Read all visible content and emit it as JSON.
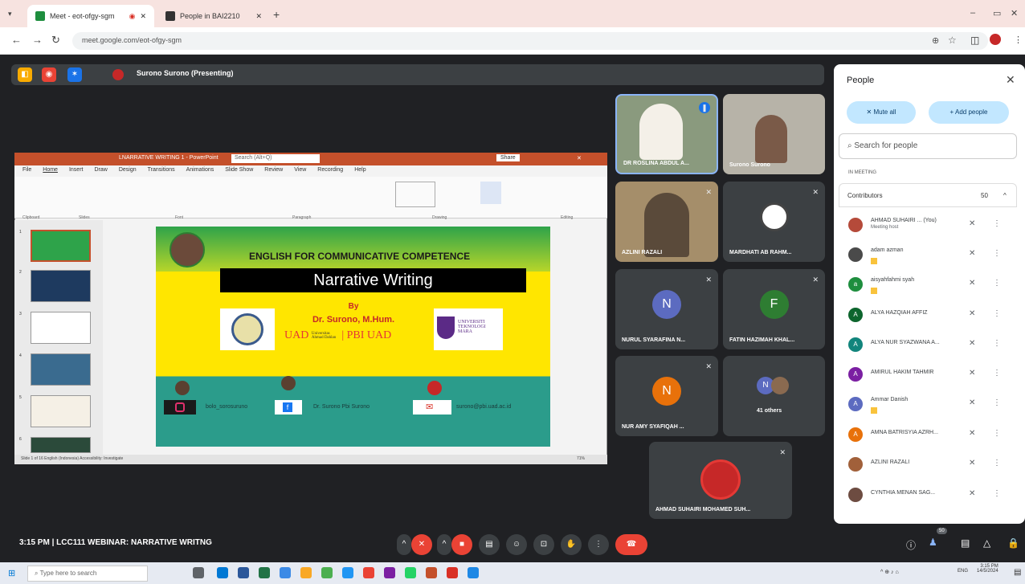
{
  "browser": {
    "tabs": [
      {
        "label": "Meet - eot-ofgy-sgm"
      },
      {
        "label": "People in BAI2210"
      }
    ],
    "url": "meet.google.com/eot-ofgy-sgm",
    "new_tab": "+"
  },
  "meet_top": {
    "presenter": "Surono Surono (Presenting)"
  },
  "ppt": {
    "title": "LNARRATIVE WRITING 1 - PowerPoint",
    "search_placeholder": "Search (Alt+Q)",
    "share": "Share",
    "menu": [
      "File",
      "Home",
      "Insert",
      "Draw",
      "Design",
      "Transitions",
      "Animations",
      "Slide Show",
      "Review",
      "View",
      "Recording",
      "Help"
    ],
    "groups": [
      "Clipboard",
      "Slides",
      "Font",
      "Paragraph",
      "Drawing",
      "Editing"
    ],
    "status": "Slide 1 of 16   English (Indonesia)   Accessibility: Investigate",
    "zoom": "71%",
    "thumb_numbers": [
      "1",
      "2",
      "3",
      "4",
      "5",
      "6"
    ]
  },
  "slide": {
    "heading": "ENGLISH FOR COMMUNICATIVE COMPETENCE",
    "title": "Narrative Writing",
    "by": "By",
    "author": "Dr. Surono, M.Hum.",
    "uad": "UAD",
    "pbi": "| PBI UAD",
    "uad_small": "Universitas Ahmad Dahlan",
    "uitm": "UNIVERSITI TEKNOLOGI MARA",
    "instagram": "bolo_sorosuruno",
    "facebook": "Dr. Surono Pbi Surono",
    "email": "surono@pbi.uad.ac.id"
  },
  "tiles": [
    {
      "name": "DR ROSLINA ABDUL A..."
    },
    {
      "name": "Surono Surono"
    },
    {
      "name": "AZLINI RAZALI"
    },
    {
      "name": "MARDHATI AB RAHM..."
    },
    {
      "name": "NURUL SYARAFINA N...",
      "initial": "N"
    },
    {
      "name": "FATIN HAZIMAH KHAL...",
      "initial": "F"
    },
    {
      "name": "NUR AMY SYAFIQAH ...",
      "initial": "N"
    },
    {
      "name": "41 others",
      "initial": "N"
    },
    {
      "name": "AHMAD SUHAIRI MOHAMED SUH..."
    }
  ],
  "people": {
    "title": "People",
    "mute_all": "Mute all",
    "add_people": "Add people",
    "search_placeholder": "Search for people",
    "in_meeting": "IN MEETING",
    "contributors": "Contributors",
    "count": "50",
    "rows": [
      {
        "name": "AHMAD SUHAIRI ... (You)",
        "sub": "Meeting host",
        "initial": "",
        "color": "#b54a3a"
      },
      {
        "name": "adam azman",
        "sub": "",
        "initial": "",
        "color": "#4a4a4a"
      },
      {
        "name": "aisyahfahmi syah",
        "sub": "",
        "initial": "a",
        "color": "#1e8e3e"
      },
      {
        "name": "ALYA HAZQIAH AFFIZ",
        "sub": "",
        "initial": "A",
        "color": "#0d652d"
      },
      {
        "name": "ALYA NUR SYAZWANA A...",
        "sub": "",
        "initial": "A",
        "color": "#12857c"
      },
      {
        "name": "AMIRUL HAKIM TAHMIR",
        "sub": "",
        "initial": "A",
        "color": "#7b1fa2"
      },
      {
        "name": "Ammar Danish",
        "sub": "",
        "initial": "A",
        "color": "#5c6bc0"
      },
      {
        "name": "AMNA BATRISYIA AZRH...",
        "sub": "",
        "initial": "A",
        "color": "#e8710a"
      },
      {
        "name": "AZLINI RAZALI",
        "sub": "",
        "initial": "",
        "color": "#a1603a"
      },
      {
        "name": "CYNTHIA MENAN SAG...",
        "sub": "",
        "initial": "",
        "color": "#6d4c41"
      }
    ]
  },
  "meeting": {
    "time_label": "3:15 PM  |  LCC111 WEBINAR: NARRATIVE WRITNG",
    "participants": "50"
  },
  "taskbar": {
    "search": "Type here to search",
    "time": "3:15 PM",
    "date": "14/5/2024",
    "lang": "ENG"
  }
}
